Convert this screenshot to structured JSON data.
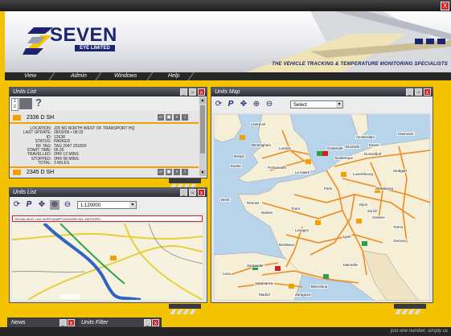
{
  "app": {
    "logo_text": "SEVEN",
    "logo_sub": "EYE LIMITED",
    "tagline": "THE VEHICLE TRACKING & TEMPERATURE MONITORING SPECIALISTS",
    "close_label": "X"
  },
  "menu": {
    "items": [
      "View",
      "Admin",
      "Windows",
      "Help"
    ]
  },
  "units_list_top": {
    "title": "Units List",
    "help_label": "?",
    "unit1": {
      "name": "2336 D SH",
      "details": [
        {
          "key": "LOCATION:",
          "value": "J25 M1 NORTH WEST OF TRANSPORT HQ"
        },
        {
          "key": "LAST UPDATE:",
          "value": "28/02/06 • 08:32"
        },
        {
          "key": "ID:",
          "value": "12638"
        },
        {
          "key": "STATUS:",
          "value": "PARKED"
        },
        {
          "key": "RF TAG:",
          "value": "TAG 2047 251830"
        },
        {
          "key": "START TIME:",
          "value": "05:35"
        },
        {
          "key": "TRAVELLED:",
          "value": "0HR 13 MINS"
        },
        {
          "key": "STOPPED:",
          "value": "0HR 08 MINS"
        },
        {
          "key": "TOTAL:",
          "value": "3 MILES"
        }
      ]
    },
    "unit2": {
      "name": "2345 D SH"
    },
    "gf_label": "GF"
  },
  "units_list_small": {
    "title": "Units List",
    "scale_value": "1:120000",
    "address": "25/2/06 08:32 • M1 NORTHAMPTONSHIRE NN, WATFORD"
  },
  "units_map": {
    "title": "Units Map",
    "select_value": "Select",
    "cities": [
      "Liverpool",
      "Birmingham",
      "Bristol",
      "Exeter",
      "London",
      "Portsmouth",
      "Amsterdam",
      "Oostende",
      "Brussels",
      "Dunkerque",
      "Essen",
      "Dusseldorf",
      "Hannover",
      "Le Havre",
      "Luxembourg",
      "Stuttgart",
      "Paris",
      "Strasbourg",
      "Brest",
      "Rennes",
      "Nantes",
      "Tours",
      "Dijon",
      "Zurich",
      "Geneve",
      "Limoges",
      "Lyon",
      "Torino",
      "Bordeaux",
      "Genova",
      "Santander",
      "Marseille",
      "Leon",
      "Barcelona",
      "Salamanca",
      "Madrid",
      "Zaragoza"
    ]
  },
  "news": {
    "title": "News"
  },
  "units_filter": {
    "title": "Units Filter"
  },
  "footer": {
    "text": "just one number, simply us"
  },
  "colors": {
    "accent": "#f3c300",
    "brand": "#1c2470",
    "close": "#d42020"
  }
}
